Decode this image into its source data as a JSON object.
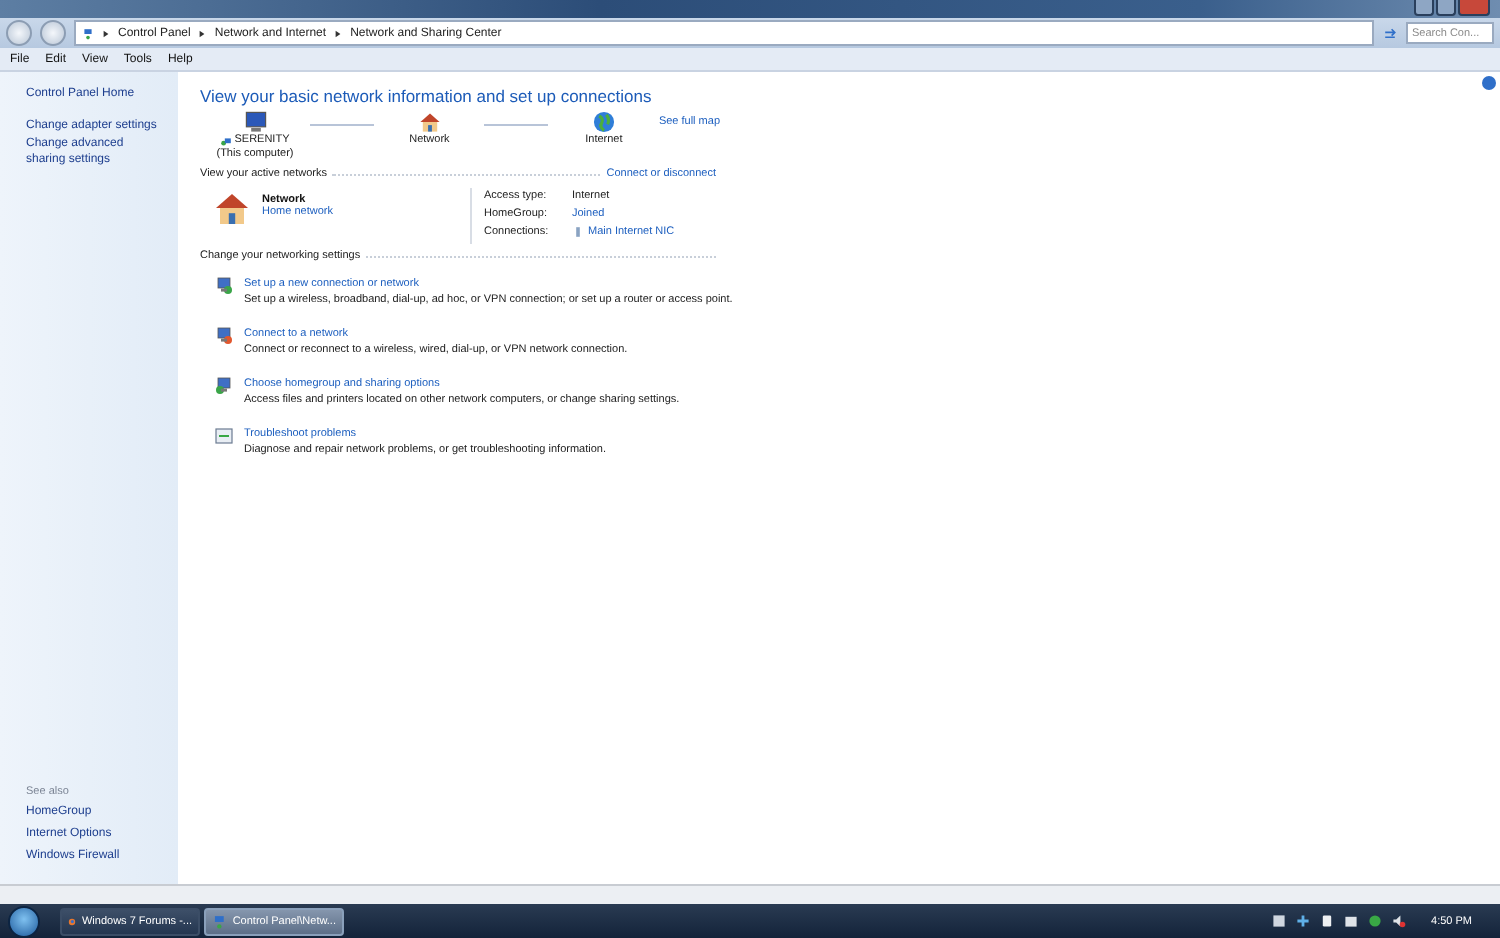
{
  "window": {
    "breadcrumb": [
      "Control Panel",
      "Network and Internet",
      "Network and Sharing Center"
    ],
    "search": {
      "placeholder": "Search Con..."
    }
  },
  "menu": [
    "File",
    "Edit",
    "View",
    "Tools",
    "Help"
  ],
  "sidebar": {
    "links": [
      "Control Panel Home",
      "Change adapter settings",
      "Change advanced sharing settings"
    ],
    "see_also_heading": "See also",
    "see_also": [
      "HomeGroup",
      "Internet Options",
      "Windows Firewall"
    ]
  },
  "main": {
    "title": "View your basic network information and set up connections",
    "map": [
      {
        "kind": "computer",
        "label": "SERENITY",
        "sublabel": "(This computer)"
      },
      {
        "kind": "house",
        "label": "Network"
      },
      {
        "kind": "globe",
        "label": "Internet"
      }
    ],
    "see_full_map": "See full map",
    "active_heading": "View your active networks",
    "connect_link": "Connect or disconnect",
    "network": {
      "name": "Network",
      "type": "Home network"
    },
    "properties": [
      {
        "label": "Access type:",
        "value": "Internet",
        "kind": "text"
      },
      {
        "label": "HomeGroup:",
        "value": "Joined",
        "kind": "link"
      },
      {
        "label": "Connections:",
        "value": "Main Internet NIC",
        "kind": "adapter"
      }
    ],
    "settings_heading": "Change your networking settings",
    "tasks": [
      {
        "title": "Set up a new connection or network",
        "description": "Set up a wireless, broadband, dial-up, ad hoc, or VPN connection; or set up a router or access point."
      },
      {
        "title": "Connect to a network",
        "description": "Connect or reconnect to a wireless, wired, dial-up, or VPN network connection."
      },
      {
        "title": "Choose homegroup and sharing options",
        "description": "Access files and printers located on other network computers, or change sharing settings."
      },
      {
        "title": "Troubleshoot problems",
        "description": "Diagnose and repair network problems, or get troubleshooting information."
      }
    ]
  },
  "taskbar": {
    "tasks": [
      {
        "label": "Windows 7 Forums -...",
        "selected": false,
        "kind": "browser"
      },
      {
        "label": "Control Panel\\Netw...",
        "selected": true,
        "kind": "network"
      }
    ],
    "clock": "4:50 PM"
  }
}
